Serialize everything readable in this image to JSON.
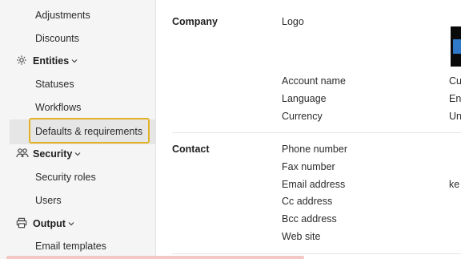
{
  "sidebar": {
    "items": [
      {
        "label": "Adjustments"
      },
      {
        "label": "Discounts"
      },
      {
        "label": "Entities",
        "group": true,
        "icon": "gear-icon"
      },
      {
        "label": "Statuses"
      },
      {
        "label": "Workflows"
      },
      {
        "label": "Defaults & requirements",
        "selected": true
      },
      {
        "label": "Security",
        "group": true,
        "icon": "people-icon"
      },
      {
        "label": "Security roles"
      },
      {
        "label": "Users"
      },
      {
        "label": "Output",
        "group": true,
        "icon": "print-icon"
      },
      {
        "label": "Email templates"
      }
    ]
  },
  "main": {
    "company": {
      "title": "Company",
      "fields": [
        {
          "label": "Logo",
          "value": ""
        },
        {
          "label": "Account name",
          "value": "Cu"
        },
        {
          "label": "Language",
          "value": "En"
        },
        {
          "label": "Currency",
          "value": "Un"
        }
      ]
    },
    "contact": {
      "title": "Contact",
      "fields": [
        {
          "label": "Phone number",
          "value": ""
        },
        {
          "label": "Fax number",
          "value": ""
        },
        {
          "label": "Email address",
          "value": "ke"
        },
        {
          "label": "Cc address",
          "value": ""
        },
        {
          "label": "Bcc address",
          "value": ""
        },
        {
          "label": "Web site",
          "value": ""
        }
      ]
    }
  },
  "colors": {
    "highlight": "#e2b127",
    "sidebar_bg": "#f5f5f5",
    "selected_bg": "#e6e6e6"
  }
}
